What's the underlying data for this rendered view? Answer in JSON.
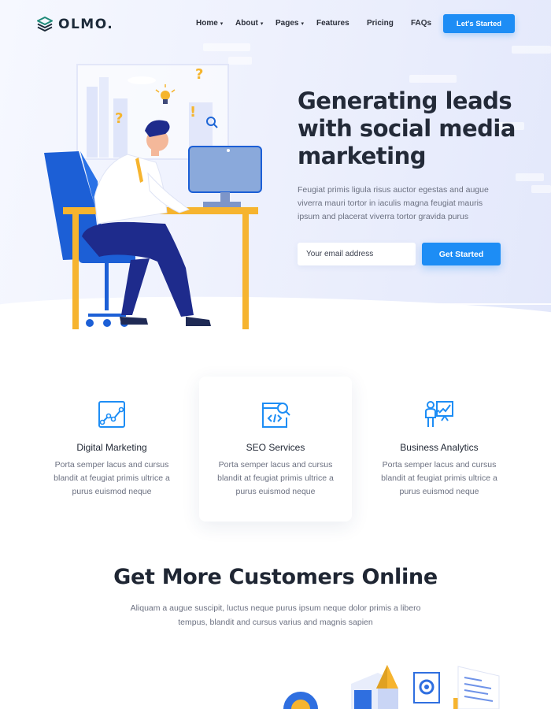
{
  "brand": {
    "name": "OLMO.",
    "accent": "#1d8df5"
  },
  "nav": {
    "items": [
      {
        "label": "Home",
        "has_dropdown": true
      },
      {
        "label": "About",
        "has_dropdown": true
      },
      {
        "label": "Pages",
        "has_dropdown": true
      },
      {
        "label": "Features",
        "has_dropdown": false
      },
      {
        "label": "Pricing",
        "has_dropdown": false
      },
      {
        "label": "FAQs",
        "has_dropdown": false
      }
    ],
    "cta_label": "Let's Started"
  },
  "hero": {
    "title": "Generating leads with social media marketing",
    "description": "Feugiat primis ligula risus auctor egestas and augue viverra mauri tortor in iaculis magna feugiat mauris ipsum and placerat viverra tortor gravida purus",
    "email_placeholder": "Your email address",
    "cta_label": "Get Started"
  },
  "services": [
    {
      "title": "Digital Marketing",
      "description": "Porta semper lacus and cursus blandit at feugiat primis ultrice a purus euismod neque",
      "icon": "chart-line-icon"
    },
    {
      "title": "SEO Services",
      "description": "Porta semper lacus and cursus blandit at feugiat primis ultrice a purus euismod neque",
      "icon": "seo-browser-icon"
    },
    {
      "title": "Business Analytics",
      "description": "Porta semper lacus and cursus blandit at feugiat primis ultrice a purus euismod neque",
      "icon": "presentation-icon"
    }
  ],
  "section2": {
    "title": "Get More Customers Online",
    "description": "Aliquam a augue suscipit, luctus neque purus ipsum neque dolor primis a libero tempus, blandit and cursus varius and magnis sapien"
  }
}
